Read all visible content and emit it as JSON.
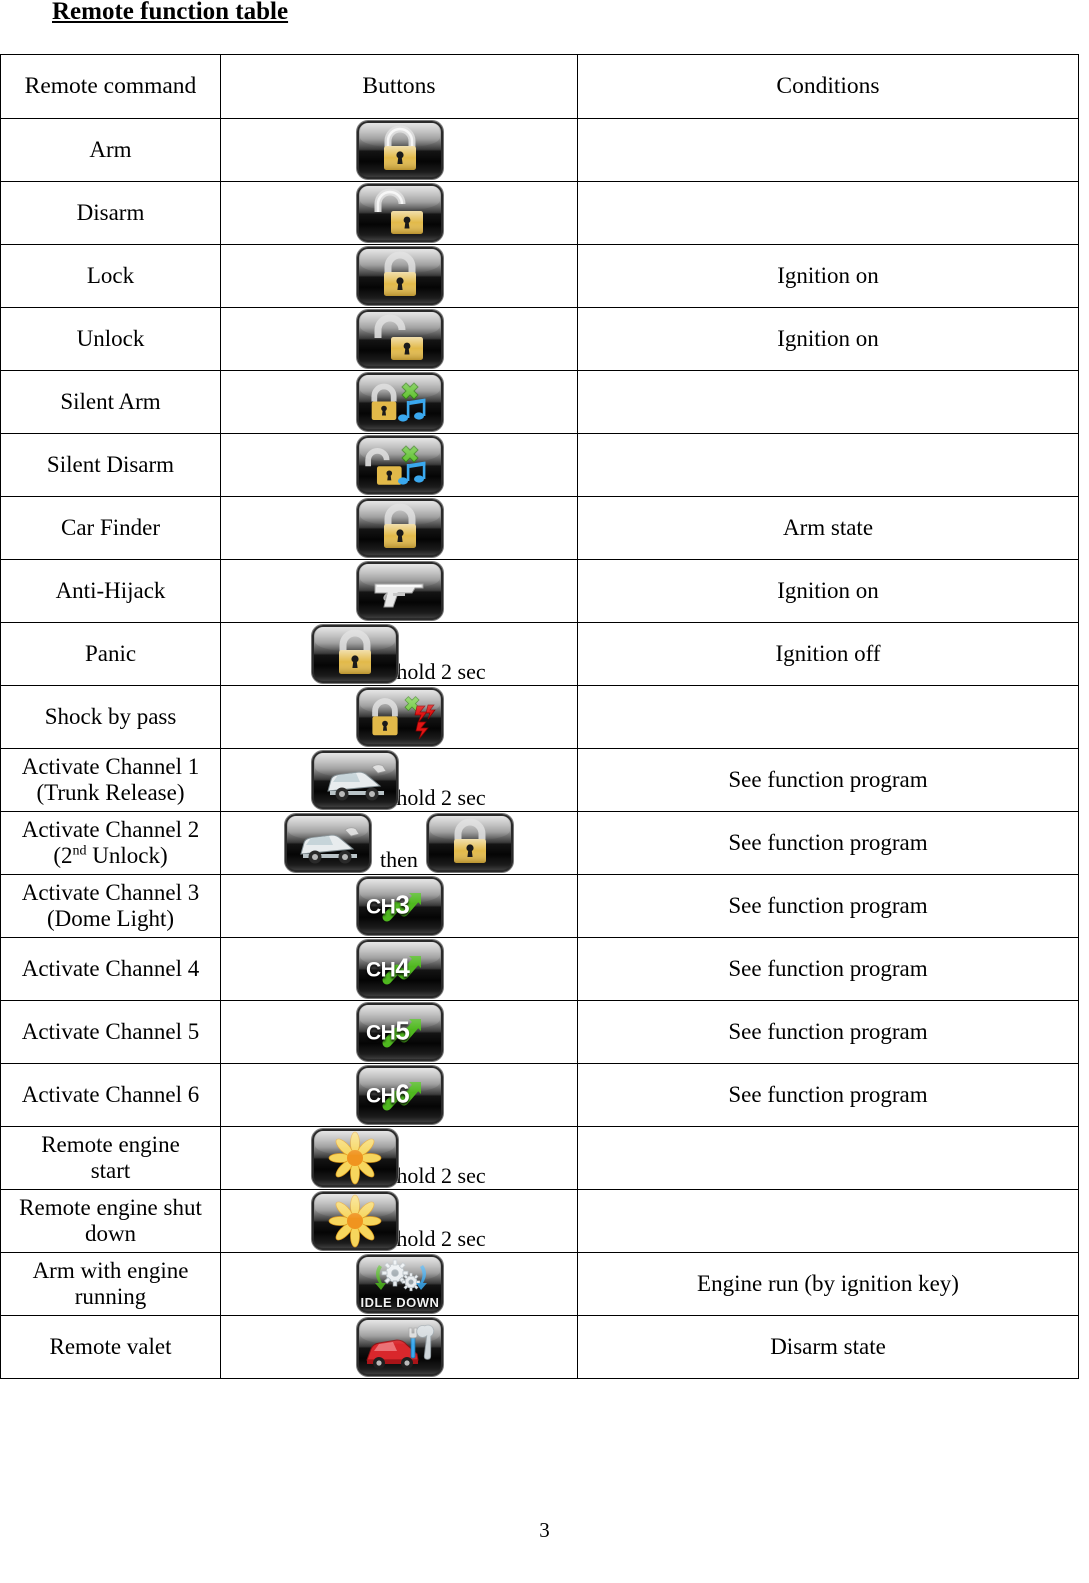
{
  "document": {
    "title": "Remote function table",
    "page_number": "3"
  },
  "table": {
    "columns": [
      "Remote command",
      "Buttons",
      "Conditions"
    ],
    "rows": [
      {
        "command": "Arm",
        "icons": [
          {
            "name": "padlock-closed-icon"
          }
        ],
        "note": "",
        "condition": ""
      },
      {
        "command": "Disarm",
        "icons": [
          {
            "name": "padlock-open-icon"
          }
        ],
        "note": "",
        "condition": ""
      },
      {
        "command": "Lock",
        "icons": [
          {
            "name": "padlock-closed-icon"
          }
        ],
        "note": "",
        "condition": "Ignition on"
      },
      {
        "command": "Unlock",
        "icons": [
          {
            "name": "padlock-open-icon"
          }
        ],
        "note": "",
        "condition": "Ignition on"
      },
      {
        "command": "Silent Arm",
        "icons": [
          {
            "name": "padlock-closed-mute-icon"
          }
        ],
        "note": "",
        "condition": ""
      },
      {
        "command": "Silent Disarm",
        "icons": [
          {
            "name": "padlock-open-mute-icon"
          }
        ],
        "note": "",
        "condition": ""
      },
      {
        "command": "Car Finder",
        "icons": [
          {
            "name": "padlock-closed-icon"
          }
        ],
        "note": "",
        "condition": "Arm state"
      },
      {
        "command": "Anti-Hijack",
        "icons": [
          {
            "name": "handgun-icon"
          }
        ],
        "note": "",
        "condition": "Ignition on"
      },
      {
        "command": "Panic",
        "icons": [
          {
            "name": "padlock-closed-icon"
          }
        ],
        "note": "hold 2 sec",
        "condition": "Ignition off"
      },
      {
        "command": "Shock by pass",
        "icons": [
          {
            "name": "padlock-shock-bypass-icon"
          }
        ],
        "note": "",
        "condition": ""
      },
      {
        "command": "Activate Channel 1\n(Trunk Release)",
        "command_line1": "Activate Channel 1",
        "command_line2": "(Trunk Release)",
        "icons": [
          {
            "name": "car-trunk-open-icon"
          }
        ],
        "note": "hold 2 sec",
        "condition": "See function program"
      },
      {
        "command": "Activate Channel 2 (2nd Unlock)",
        "command_line1": "Activate Channel 2",
        "command_line2_pre": "(2",
        "command_line2_sup": "nd",
        "command_line2_post": "  Unlock)",
        "icons": [
          {
            "name": "car-trunk-open-icon"
          },
          {
            "name": "padlock-closed-icon"
          }
        ],
        "note": "then",
        "condition": "See function program"
      },
      {
        "command": "Activate Channel 3\n(Dome Light)",
        "command_line1": "Activate Channel 3",
        "command_line2": "(Dome Light)",
        "icons": [
          {
            "name": "channel-3-icon",
            "label": "CH",
            "number": "3"
          }
        ],
        "note": "",
        "condition": "See function program"
      },
      {
        "command": "Activate Channel 4",
        "icons": [
          {
            "name": "channel-4-icon",
            "label": "CH",
            "number": "4"
          }
        ],
        "note": "",
        "condition": "See function program"
      },
      {
        "command": "Activate Channel 5",
        "icons": [
          {
            "name": "channel-5-icon",
            "label": "CH",
            "number": "5"
          }
        ],
        "note": "",
        "condition": "See function program"
      },
      {
        "command": "Activate Channel 6",
        "icons": [
          {
            "name": "channel-6-icon",
            "label": "CH",
            "number": "6"
          }
        ],
        "note": "",
        "condition": "See function program"
      },
      {
        "command": "Remote engine start",
        "command_line1": "Remote engine",
        "command_line2": "start",
        "icons": [
          {
            "name": "engine-start-sunburst-icon"
          }
        ],
        "note": "hold 2 sec",
        "condition": ""
      },
      {
        "command": "Remote engine shut down",
        "command_line1": "Remote engine shut",
        "command_line2": "down",
        "icons": [
          {
            "name": "engine-start-sunburst-icon"
          }
        ],
        "note": "hold 2 sec",
        "condition": ""
      },
      {
        "command": "Arm with engine running",
        "command_line1": "Arm with engine",
        "command_line2": "running",
        "icons": [
          {
            "name": "idle-down-gears-icon",
            "label": "IDLE DOWN"
          }
        ],
        "note": "",
        "condition": "Engine run (by ignition key)"
      },
      {
        "command": "Remote valet",
        "icons": [
          {
            "name": "valet-car-tools-icon"
          }
        ],
        "note": "",
        "condition": "Disarm state"
      }
    ]
  },
  "colors": {
    "text": "#000000",
    "border": "#000000",
    "lock_gold": "#e0b84a",
    "accent_green": "#55bb22",
    "accent_red": "#e21515",
    "accent_blue": "#2f9fe8",
    "sunburst_yellow": "#f7d857",
    "sunburst_orange": "#f09020",
    "valet_red": "#d9272c"
  }
}
